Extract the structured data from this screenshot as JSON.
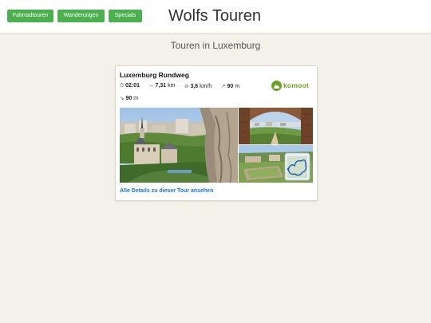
{
  "nav": {
    "items": [
      {
        "label": "Fahrradtouren"
      },
      {
        "label": "Wanderungen"
      },
      {
        "label": "Specials"
      }
    ],
    "brand": "Wolfs Touren",
    "button_color": "#4caf50"
  },
  "page": {
    "heading": "Touren in Luxemburg",
    "background": "#f4f2e8"
  },
  "tour": {
    "title": "Luxemburg Rundweg",
    "duration": "02:01",
    "distance": "7,31",
    "distance_unit": "km",
    "speed": "3,6",
    "speed_unit": "km/h",
    "ascent": "90",
    "ascent_unit": "m",
    "descent": "90",
    "descent_unit": "m",
    "provider": "komoot",
    "provider_color": "#6aa127",
    "details_link": "Alle Details zu dieser Tour ansehen",
    "link_color": "#1a73c8"
  }
}
